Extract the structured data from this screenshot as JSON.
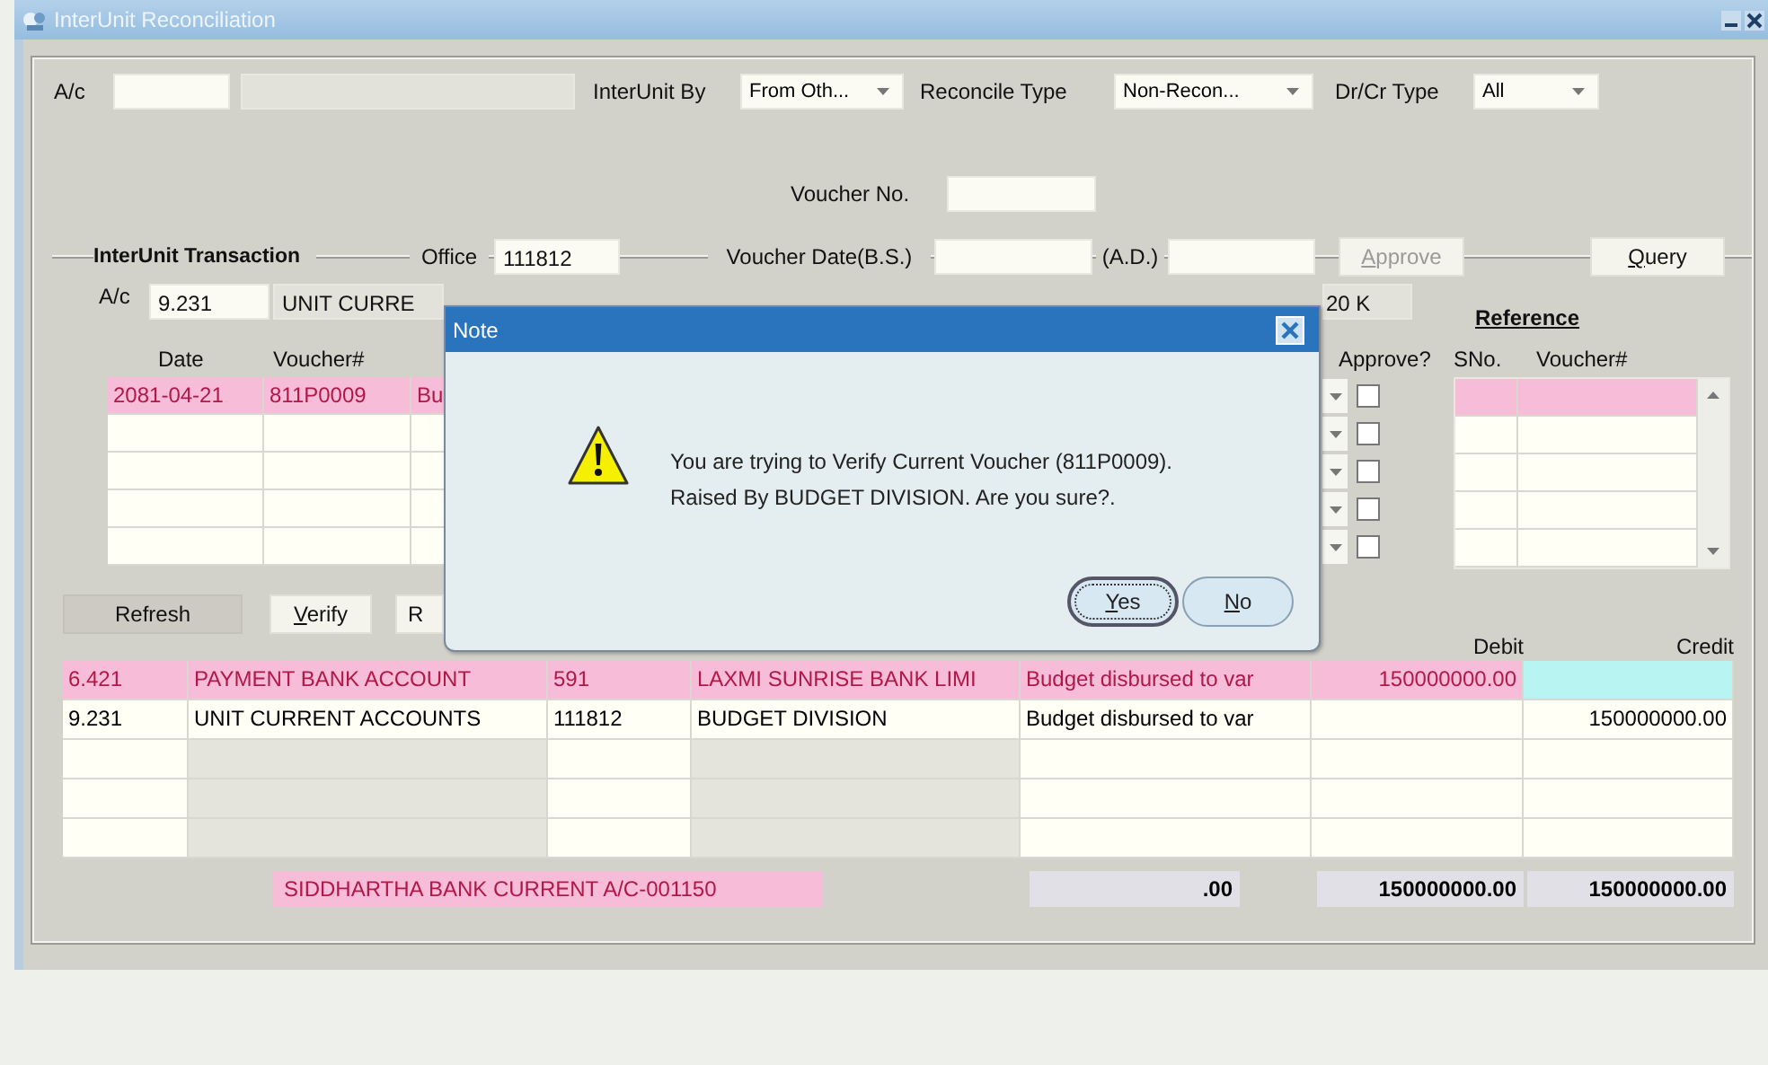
{
  "window": {
    "title": "InterUnit Reconciliation"
  },
  "filters": [
    {
      "kind": "account",
      "label": "A/c"
    },
    {
      "kind": "select",
      "label": "InterUnit By",
      "value": "From Oth..."
    },
    {
      "kind": "select",
      "label": "Reconcile Type",
      "value": "Non-Recon..."
    },
    {
      "kind": "select",
      "label": "Dr/Cr Type",
      "value": "All"
    }
  ],
  "voucher_no": {
    "label": "Voucher No."
  },
  "transaction": {
    "title": "InterUnit Transaction",
    "office_label": "Office",
    "office": "111812",
    "date_bs_label": "Voucher Date(B.S.)",
    "date_ad_label": "(A.D.)",
    "buttons": [
      {
        "label": "Approve",
        "disabled": true,
        "mnemonic": true
      },
      {
        "label": "Query",
        "disabled": false,
        "mnemonic": true
      }
    ]
  },
  "account": {
    "label": "A/c",
    "code": "9.231",
    "name": "UNIT CURRE",
    "column_3": "20 K"
  },
  "vouchers": {
    "columns": [
      "Date",
      "Voucher#"
    ],
    "approve_label": "Approve?",
    "rows": [
      {
        "date": "2081-04-21",
        "voucher": "811P0009",
        "column_3": "Bu",
        "selected": true,
        "approve": false
      },
      {
        "selected": false,
        "approve": false
      },
      {
        "selected": false,
        "approve": false
      },
      {
        "selected": false,
        "approve": false
      },
      {
        "selected": false,
        "approve": false
      }
    ]
  },
  "reference": {
    "title": "Reference",
    "columns": [
      "SNo.",
      "Voucher#"
    ],
    "rows": [
      {
        "selected": true
      },
      {
        "selected": false
      },
      {
        "selected": false
      },
      {
        "selected": false
      },
      {
        "selected": false
      }
    ]
  },
  "buttons": [
    {
      "label": "Refresh",
      "kind": "flat",
      "mnemonic": false
    },
    {
      "label": "Verify",
      "kind": "raised",
      "mnemonic": true
    },
    {
      "label": "R",
      "kind": "raised",
      "mnemonic": false
    }
  ],
  "entries": {
    "debit_header": "Debit",
    "credit_header": "Credit",
    "rows": [
      {
        "column_1": "6.421",
        "column_2": "PAYMENT BANK ACCOUNT",
        "column_3": "591",
        "column_4": "LAXMI SUNRISE BANK LIMI",
        "column_5": "Budget disbursed to var",
        "debit": "150000000.00",
        "selected": true,
        "credit_focused": true
      },
      {
        "column_1": "9.231",
        "column_2": "UNIT CURRENT ACCOUNTS",
        "column_3": "111812",
        "column_4": "BUDGET DIVISION",
        "column_5": "Budget disbursed to var",
        "credit": "150000000.00",
        "selected": false,
        "credit_focused": false
      },
      {
        "selected": false,
        "credit_focused": false
      },
      {
        "selected": false,
        "credit_focused": false
      },
      {
        "selected": false,
        "credit_focused": false
      }
    ]
  },
  "totals": {
    "bank": "SIDDHARTHA BANK  CURRENT A/C-001150",
    "difference": ".00",
    "debit_total": "150000000.00",
    "credit_total": "150000000.00"
  },
  "dialog": {
    "title": "Note",
    "message_lines": [
      "You are trying to Verify Current Voucher (811P0009).",
      "Raised By BUDGET DIVISION. Are you sure?."
    ],
    "buttons": [
      {
        "label": "Yes",
        "selected": true,
        "mnemonic": true
      },
      {
        "label": "No",
        "selected": false,
        "mnemonic": true
      }
    ]
  }
}
